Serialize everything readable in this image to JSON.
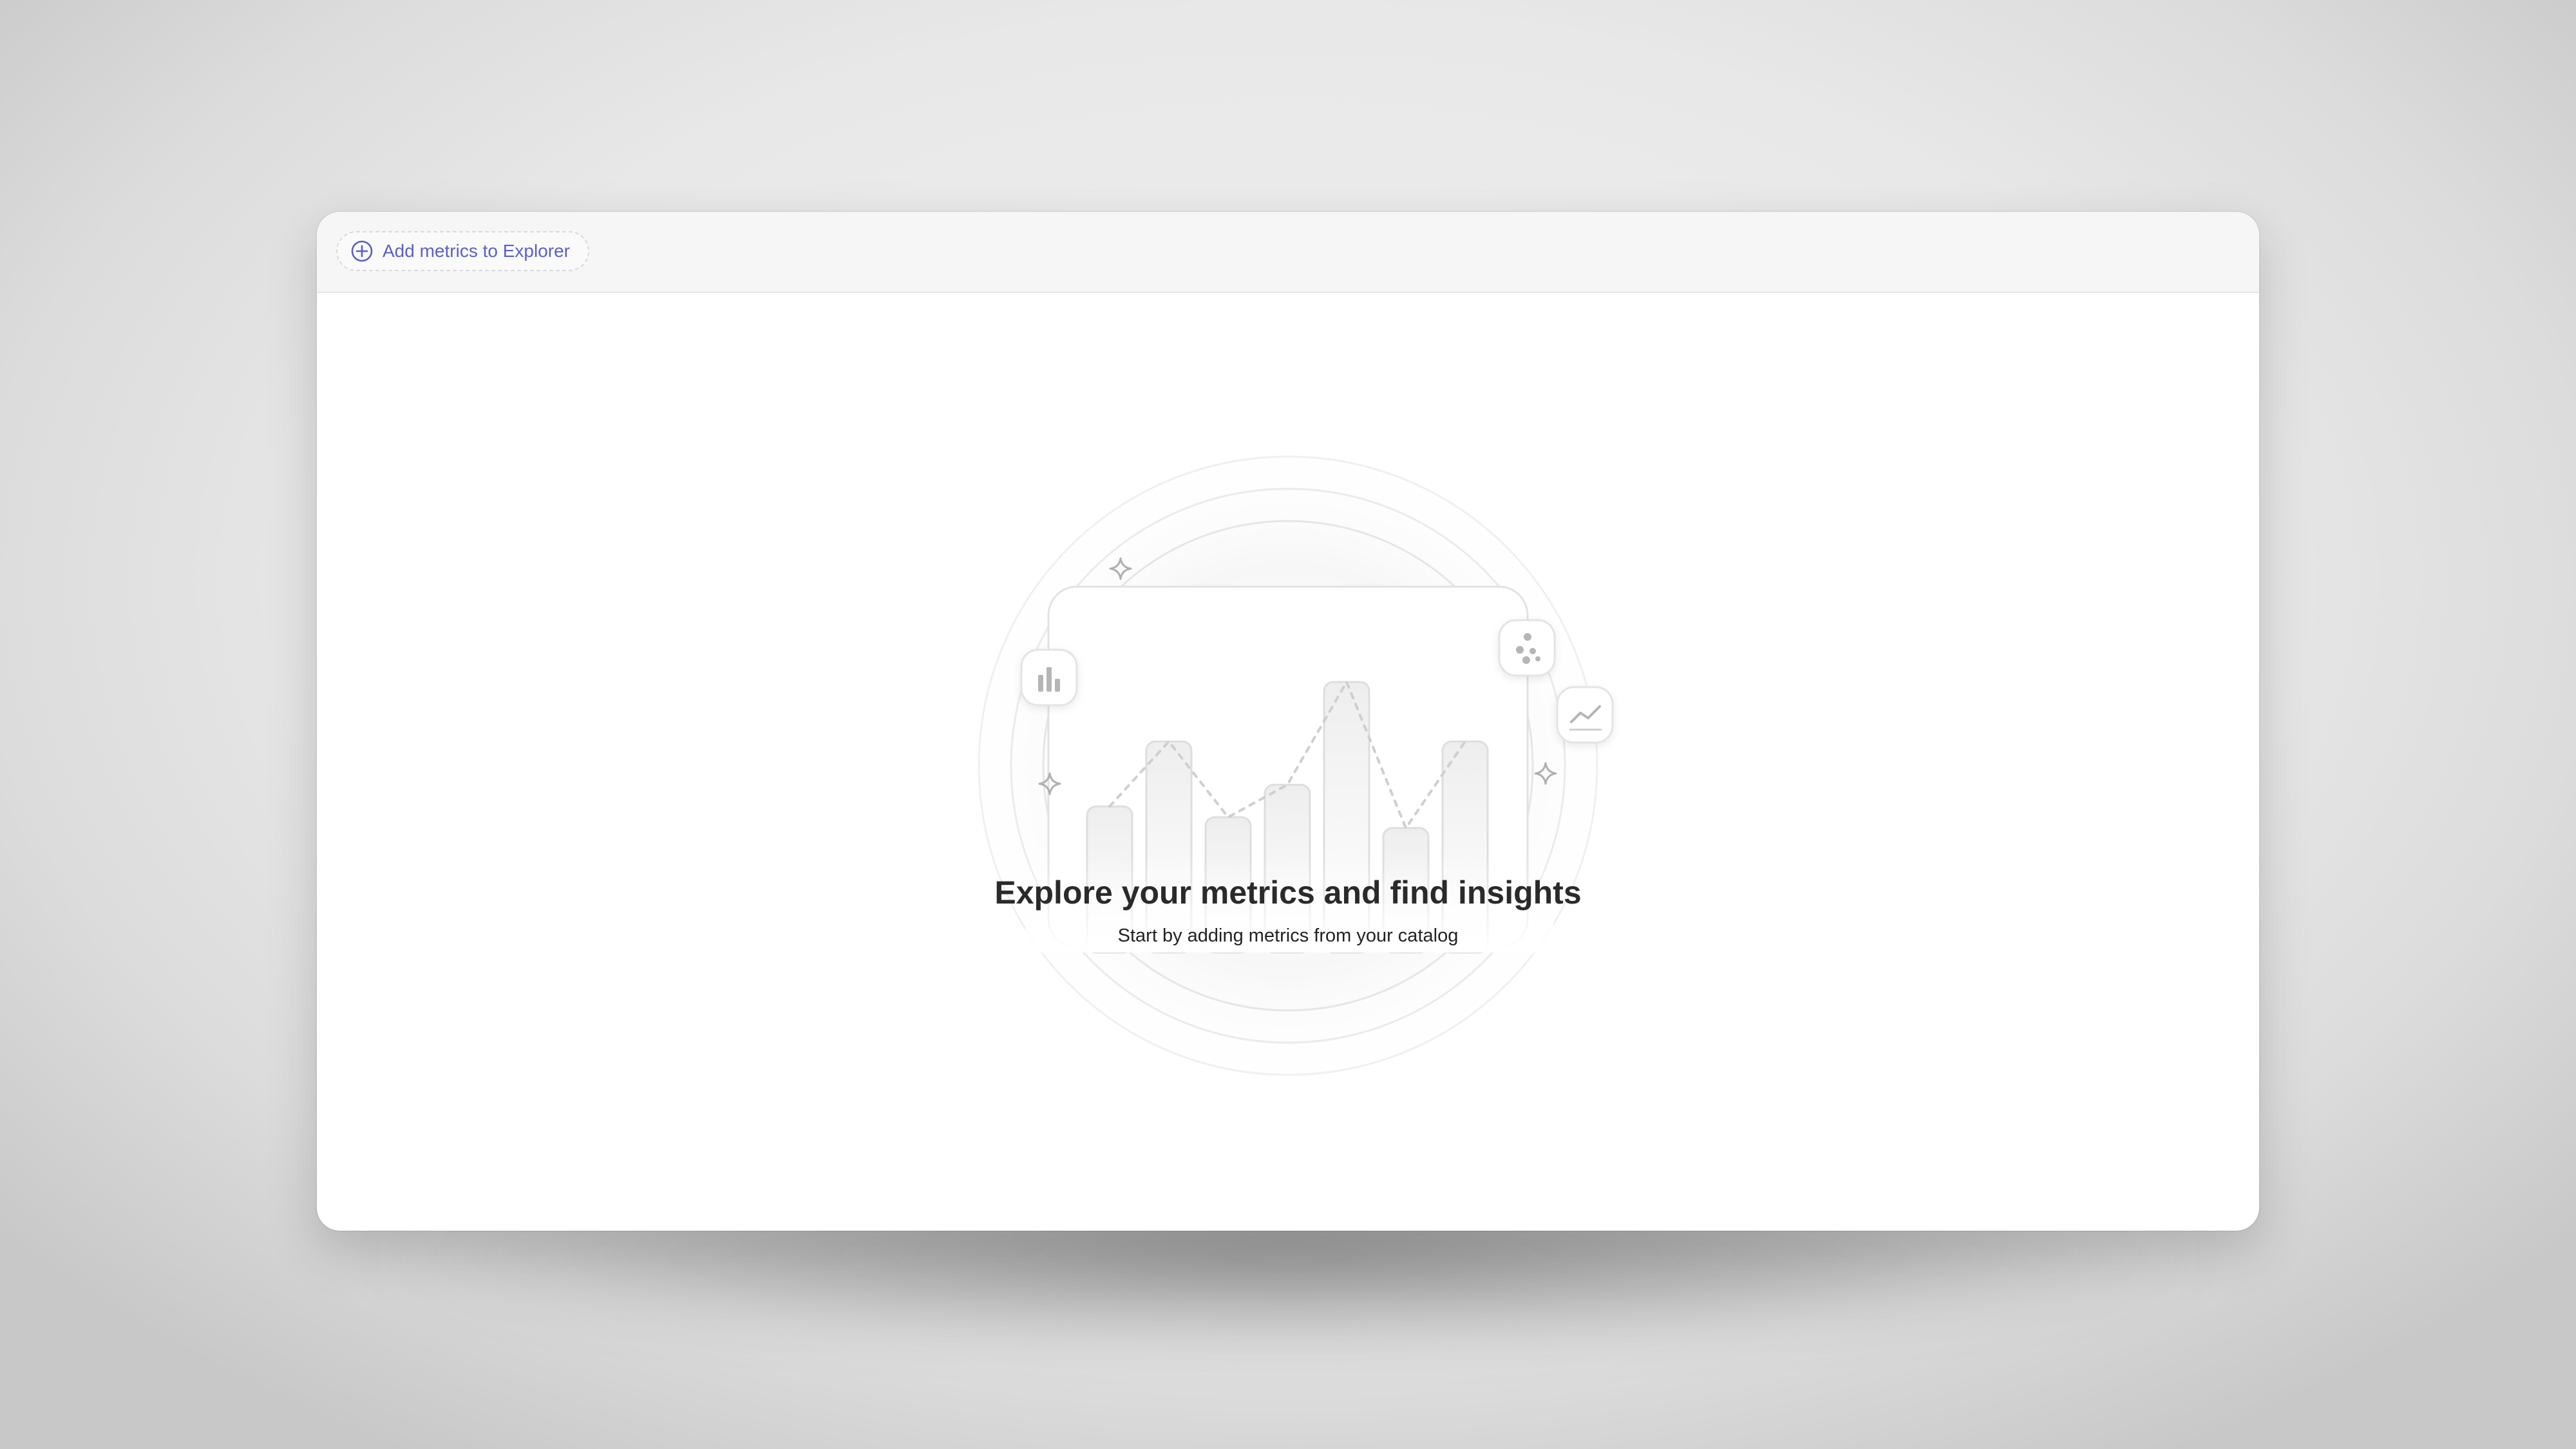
{
  "toolbar": {
    "add_metrics_label": "Add metrics to Explorer",
    "add_icon": "plus-circle-icon"
  },
  "empty_state": {
    "title": "Explore your metrics and find insights",
    "subtitle": "Start by adding metrics from your catalog"
  },
  "illustration": {
    "chart_icons": [
      "bar-chart-icon",
      "scatter-icon",
      "line-chart-icon"
    ],
    "sparkle_icons": [
      "sparkle-icon",
      "sparkle-icon",
      "sparkle-icon"
    ],
    "bar_levels": [
      0.54,
      0.78,
      0.5,
      0.62,
      1.0,
      0.46,
      0.78
    ]
  },
  "colors": {
    "accent": "#5b5fc7",
    "heading": "#2a2a2a",
    "muted_icon": "#b5b5b5"
  }
}
